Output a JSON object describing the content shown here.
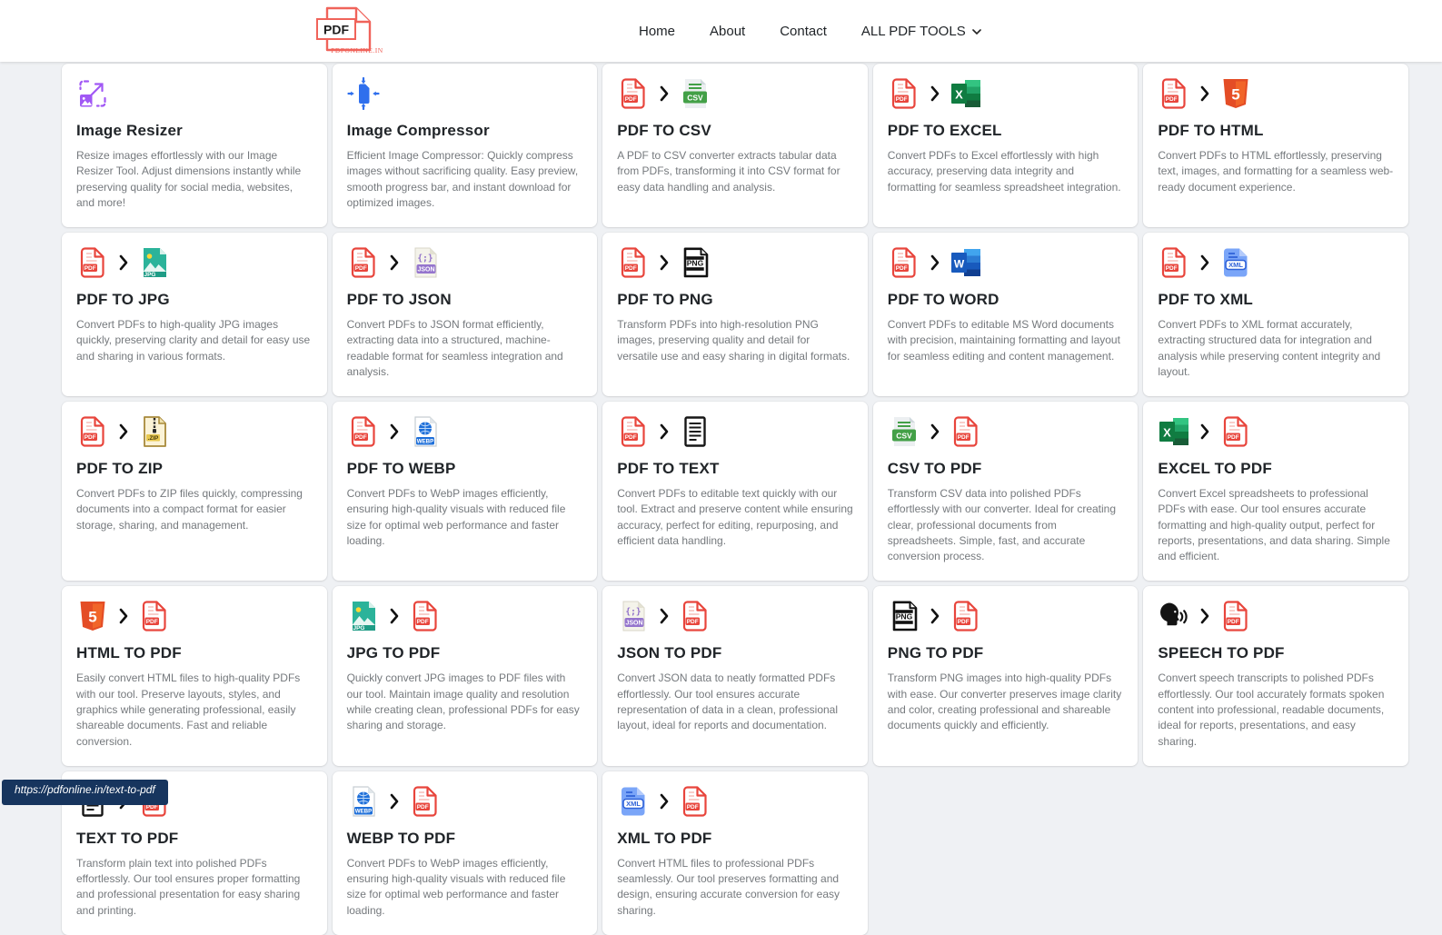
{
  "header": {
    "logo": {
      "text": "PDF",
      "subtext": "PDFONLINE.IN"
    },
    "nav": [
      {
        "label": "Home"
      },
      {
        "label": "About"
      },
      {
        "label": "Contact"
      },
      {
        "label": "ALL PDF TOOLS",
        "has_dropdown": true
      }
    ]
  },
  "colors": {
    "accent_red": "#e8453c",
    "page_background": "#eff1f4",
    "card_background": "#ffffff",
    "title_text": "#212529",
    "description_text": "#75797d",
    "status_bar_background": "#17355e"
  },
  "status_bar": {
    "text": "https://pdfonline.in/text-to-pdf"
  },
  "tools": [
    {
      "title": "Image Resizer",
      "icons": [
        "image-resizer"
      ],
      "description": "Resize images effortlessly with our Image Resizer Tool. Adjust dimensions instantly while preserving quality for social media, websites, and more!"
    },
    {
      "title": "Image Compressor",
      "icons": [
        "image-compressor"
      ],
      "description": "Efficient Image Compressor: Quickly compress images without sacrificing quality. Easy preview, smooth progress bar, and instant download for optimized images."
    },
    {
      "title": "PDF TO CSV",
      "icons": [
        "pdf",
        "csv"
      ],
      "description": "A PDF to CSV converter extracts tabular data from PDFs, transforming it into CSV format for easy data handling and analysis."
    },
    {
      "title": "PDF TO EXCEL",
      "icons": [
        "pdf",
        "excel"
      ],
      "description": "Convert PDFs to Excel effortlessly with high accuracy, preserving data integrity and formatting for seamless spreadsheet integration."
    },
    {
      "title": "PDF TO HTML",
      "icons": [
        "pdf",
        "html5"
      ],
      "description": "Convert PDFs to HTML effortlessly, preserving text, images, and formatting for a seamless web-ready document experience."
    },
    {
      "title": "PDF TO JPG",
      "icons": [
        "pdf",
        "jpg"
      ],
      "description": "Convert PDFs to high-quality JPG images quickly, preserving clarity and detail for easy use and sharing in various formats."
    },
    {
      "title": "PDF TO JSON",
      "icons": [
        "pdf",
        "json"
      ],
      "description": "Convert PDFs to JSON format efficiently, extracting data into a structured, machine-readable format for seamless integration and analysis."
    },
    {
      "title": "PDF TO PNG",
      "icons": [
        "pdf",
        "png"
      ],
      "description": "Transform PDFs into high-resolution PNG images, preserving quality and detail for versatile use and easy sharing in digital formats."
    },
    {
      "title": "PDF TO WORD",
      "icons": [
        "pdf",
        "word"
      ],
      "description": "Convert PDFs to editable MS Word documents with precision, maintaining formatting and layout for seamless editing and content management."
    },
    {
      "title": "PDF TO XML",
      "icons": [
        "pdf",
        "xml"
      ],
      "description": "Convert PDFs to XML format accurately, extracting structured data for integration and analysis while preserving content integrity and layout."
    },
    {
      "title": "PDF TO ZIP",
      "icons": [
        "pdf",
        "zip"
      ],
      "description": "Convert PDFs to ZIP files quickly, compressing documents into a compact format for easier storage, sharing, and management."
    },
    {
      "title": "PDF TO WEBP",
      "icons": [
        "pdf",
        "webp"
      ],
      "description": "Convert PDFs to WebP images efficiently, ensuring high-quality visuals with reduced file size for optimal web performance and faster loading."
    },
    {
      "title": "PDF TO TEXT",
      "icons": [
        "pdf",
        "text"
      ],
      "description": "Convert PDFs to editable text quickly with our tool. Extract and preserve content while ensuring accuracy, perfect for editing, repurposing, and efficient data handling."
    },
    {
      "title": "CSV TO PDF",
      "icons": [
        "csv",
        "pdf"
      ],
      "description": "Transform CSV data into polished PDFs effortlessly with our converter. Ideal for creating clear, professional documents from spreadsheets. Simple, fast, and accurate conversion process."
    },
    {
      "title": "EXCEL TO PDF",
      "icons": [
        "excel",
        "pdf"
      ],
      "description": "Convert Excel spreadsheets to professional PDFs with ease. Our tool ensures accurate formatting and high-quality output, perfect for reports, presentations, and data sharing. Simple and efficient."
    },
    {
      "title": "HTML TO PDF",
      "icons": [
        "html5",
        "pdf"
      ],
      "description": "Easily convert HTML files to high-quality PDFs with our tool. Preserve layouts, styles, and graphics while generating professional, easily shareable documents. Fast and reliable conversion."
    },
    {
      "title": "JPG TO PDF",
      "icons": [
        "jpg",
        "pdf"
      ],
      "description": "Quickly convert JPG images to PDF files with our tool. Maintain image quality and resolution while creating clean, professional PDFs for easy sharing and storage."
    },
    {
      "title": "JSON TO PDF",
      "icons": [
        "json",
        "pdf"
      ],
      "description": "Convert JSON data to neatly formatted PDFs effortlessly. Our tool ensures accurate representation of data in a clean, professional layout, ideal for reports and documentation."
    },
    {
      "title": "PNG TO PDF",
      "icons": [
        "png",
        "pdf"
      ],
      "description": "Transform PNG images into high-quality PDFs with ease. Our converter preserves image clarity and color, creating professional and shareable documents quickly and efficiently."
    },
    {
      "title": "SPEECH TO PDF",
      "icons": [
        "speech",
        "pdf"
      ],
      "description": "Convert speech transcripts to polished PDFs effortlessly. Our tool accurately formats spoken content into professional, readable documents, ideal for reports, presentations, and easy sharing."
    },
    {
      "title": "TEXT TO PDF",
      "icons": [
        "text",
        "pdf"
      ],
      "description": "Transform plain text into polished PDFs effortlessly. Our tool ensures proper formatting and professional presentation for easy sharing and printing."
    },
    {
      "title": "WEBP TO PDF",
      "icons": [
        "webp",
        "pdf"
      ],
      "description": "Convert PDFs to WebP images efficiently, ensuring high-quality visuals with reduced file size for optimal web performance and faster loading."
    },
    {
      "title": "XML TO PDF",
      "icons": [
        "xml",
        "pdf"
      ],
      "description": "Convert HTML files to professional PDFs seamlessly. Our tool preserves formatting and design, ensuring accurate conversion for easy sharing."
    }
  ]
}
